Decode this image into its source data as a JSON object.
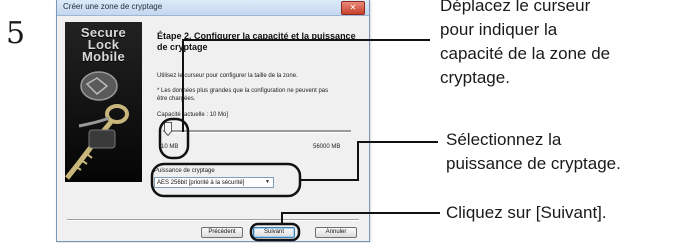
{
  "step_number": "5",
  "dialog": {
    "title": "Créer une zone de cryptage",
    "close_glyph": "✕",
    "brand_lines": [
      "Secure",
      "Lock",
      "Mobile"
    ],
    "heading": "Étape 2. Configurer la capacité et la puissance de cryptage",
    "instruction": "Utilisez le curseur pour configurer la taille de la zone.",
    "warning": "* Les données plus grandes que la configuration ne peuvent pas être chargées.",
    "capacity_label": "Capacité [actuelle : 10 Mo]",
    "slider": {
      "min_label": "10 MB",
      "max_label": "56000 MB",
      "value_fraction": 0.0
    },
    "encryption": {
      "group_label": "Puissance de cryptage",
      "selected": "AES 256bit [priorité à la sécurité]"
    },
    "buttons": {
      "back": "Précédent",
      "next": "Suivant",
      "cancel": "Annuler"
    }
  },
  "callouts": {
    "slider_lines": [
      "Déplacez le curseur",
      "pour indiquer la",
      "capacité de la zone de",
      "cryptage."
    ],
    "encryption_lines": [
      "Sélectionnez la",
      "puissance de cryptage."
    ],
    "next_line": "Cliquez sur [Suivant]."
  },
  "colors": {
    "title_bar": "#c4d7ef",
    "close_button": "#c6412b",
    "brand_panel": "#111111",
    "default_button_border": "#3c7fb1"
  },
  "icons": {
    "close": "close-icon",
    "dropdown": "chevron-down-icon",
    "brand_art": "key-lock-icon"
  }
}
